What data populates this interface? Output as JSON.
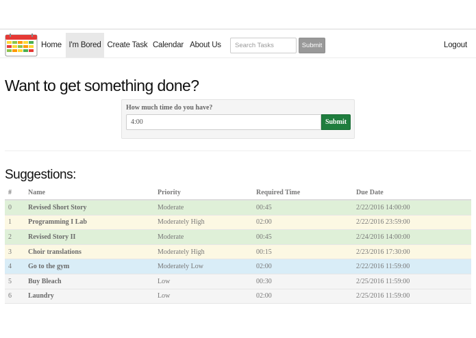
{
  "nav": {
    "items": [
      {
        "label": "Home",
        "active": false
      },
      {
        "label": "I'm Bored",
        "active": true
      },
      {
        "label": "Create Task",
        "active": false
      },
      {
        "label": "Calendar",
        "active": false
      },
      {
        "label": "About Us",
        "active": false
      }
    ],
    "search_placeholder": "Search Tasks",
    "search_button": "Submit",
    "logout": "Logout"
  },
  "headline": "Want to get something done?",
  "time_form": {
    "label": "How much time do you have?",
    "value": "4:00",
    "submit": "Submit"
  },
  "suggestions": {
    "title": "Suggestions:",
    "columns": [
      "#",
      "Name",
      "Priority",
      "Required Time",
      "Due Date"
    ],
    "rows": [
      {
        "idx": "0",
        "name": "Revised Short Story",
        "priority": "Moderate",
        "time": "00:45",
        "due": "2/22/2016 14:00:00",
        "style": "success"
      },
      {
        "idx": "1",
        "name": "Programming I Lab",
        "priority": "Moderately High",
        "time": "02:00",
        "due": "2/22/2016 23:59:00",
        "style": "warning"
      },
      {
        "idx": "2",
        "name": "Revised Story II",
        "priority": "Moderate",
        "time": "00:45",
        "due": "2/24/2016 14:00:00",
        "style": "success"
      },
      {
        "idx": "3",
        "name": "Choir translations",
        "priority": "Moderately High",
        "time": "00:15",
        "due": "2/23/2016 17:30:00",
        "style": "warning"
      },
      {
        "idx": "4",
        "name": "Go to the gym",
        "priority": "Moderately Low",
        "time": "02:00",
        "due": "2/22/2016 11:59:00",
        "style": "info"
      },
      {
        "idx": "5",
        "name": "Buy Bleach",
        "priority": "Low",
        "time": "00:30",
        "due": "2/25/2016 11:59:00",
        "style": "plain"
      },
      {
        "idx": "6",
        "name": "Laundry",
        "priority": "Low",
        "time": "02:00",
        "due": "2/25/2016 11:59:00",
        "style": "plain"
      }
    ]
  },
  "colors": {
    "success_row": "#dff0d8",
    "warning_row": "#fcf8e3",
    "info_row": "#d9edf7",
    "submit_green": "#1f7d3e",
    "search_button_gray": "#999999"
  },
  "icons": {
    "logo": "calendar-icon"
  }
}
